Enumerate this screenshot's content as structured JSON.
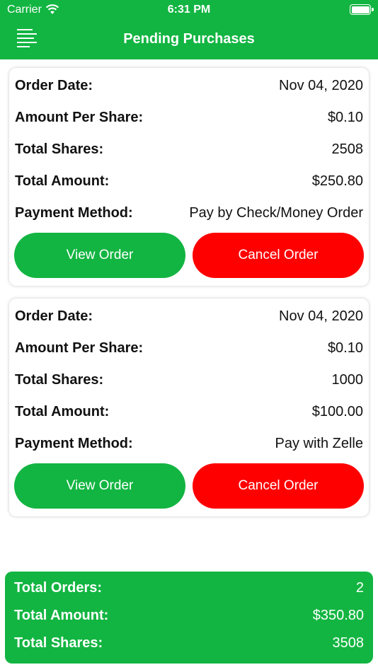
{
  "status_bar": {
    "carrier": "Carrier",
    "time": "6:31 PM"
  },
  "nav": {
    "title": "Pending Purchases"
  },
  "orders": [
    {
      "order_date_label": "Order Date:",
      "order_date": "Nov 04, 2020",
      "amount_per_share_label": "Amount Per Share:",
      "amount_per_share": "$0.10",
      "total_shares_label": "Total Shares:",
      "total_shares": "2508",
      "total_amount_label": "Total Amount:",
      "total_amount": "$250.80",
      "payment_method_label": "Payment Method:",
      "payment_method": "Pay by Check/Money Order",
      "view_label": "View Order",
      "cancel_label": "Cancel Order"
    },
    {
      "order_date_label": "Order Date:",
      "order_date": "Nov 04, 2020",
      "amount_per_share_label": "Amount Per Share:",
      "amount_per_share": "$0.10",
      "total_shares_label": "Total Shares:",
      "total_shares": "1000",
      "total_amount_label": "Total Amount:",
      "total_amount": "$100.00",
      "payment_method_label": "Payment Method:",
      "payment_method": "Pay with Zelle",
      "view_label": "View Order",
      "cancel_label": "Cancel Order"
    }
  ],
  "summary": {
    "total_orders_label": "Total Orders:",
    "total_orders": "2",
    "total_amount_label": "Total Amount:",
    "total_amount": "$350.80",
    "total_shares_label": "Total Shares:",
    "total_shares": "3508"
  },
  "colors": {
    "brand_green": "#12b541",
    "cancel_red": "#ff0000"
  },
  "icons": {
    "menu": "menu-icon",
    "wifi": "wifi-icon",
    "battery": "battery-icon"
  }
}
